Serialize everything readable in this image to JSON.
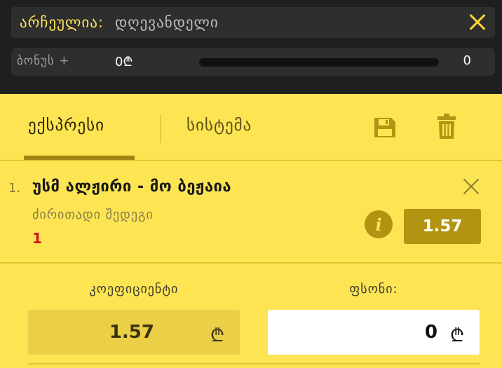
{
  "selection": {
    "label": "არჩეულია:",
    "value": "დღევანდელი"
  },
  "bonus": {
    "label": "ბონუს +",
    "amount": "0₾",
    "count": "0",
    "progress": 0
  },
  "tabs": [
    {
      "label": "ექსპრესი",
      "active": true
    },
    {
      "label": "სისტემა",
      "active": false
    }
  ],
  "icons": {
    "close": "close-icon",
    "save": "save-icon",
    "trash": "trash-icon",
    "info": "info-icon",
    "remove": "remove-icon"
  },
  "bet": {
    "index": "1.",
    "title": "უსმ ალჟირი - მო ბეჟაია",
    "market": "ძირითადი შედეგი",
    "pick": "1",
    "info_glyph": "i",
    "odd": "1.57"
  },
  "summary": {
    "coef_label": "კოეფიციენტი",
    "coef_value": "1.57",
    "stake_label": "ფსონი:",
    "stake_value": "0",
    "currency": "₾"
  },
  "colors": {
    "accent": "#ffd633",
    "panel": "#fde453",
    "dark": "#1f1f1f",
    "odd_bg": "#b39412",
    "pick": "#c8161d"
  }
}
